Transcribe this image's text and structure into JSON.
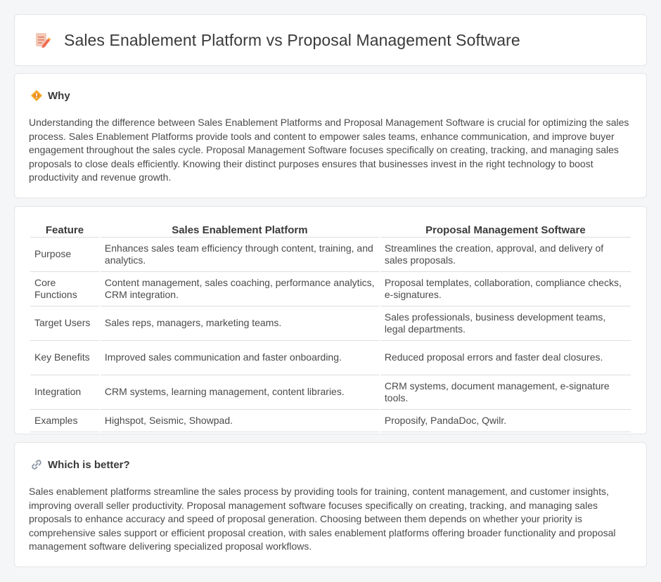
{
  "header": {
    "title": "Sales Enablement Platform vs Proposal Management Software",
    "icon": "document-pencil-icon"
  },
  "why": {
    "title": "Why",
    "icon": "diamond-icon",
    "text": "Understanding the difference between Sales Enablement Platforms and Proposal Management Software is crucial for optimizing the sales process. Sales Enablement Platforms provide tools and content to empower sales teams, enhance communication, and improve buyer engagement throughout the sales cycle. Proposal Management Software focuses specifically on creating, tracking, and managing sales proposals to close deals efficiently. Knowing their distinct purposes ensures that businesses invest in the right technology to boost productivity and revenue growth."
  },
  "table": {
    "headers": [
      "Feature",
      "Sales Enablement Platform",
      "Proposal Management Software"
    ],
    "rows": [
      [
        "Purpose",
        "Enhances sales team efficiency through content, training, and analytics.",
        "Streamlines the creation, approval, and delivery of sales proposals."
      ],
      [
        "Core Functions",
        "Content management, sales coaching, performance analytics, CRM integration.",
        "Proposal templates, collaboration, compliance checks, e-signatures."
      ],
      [
        "Target Users",
        "Sales reps, managers, marketing teams.",
        "Sales professionals, business development teams, legal departments."
      ],
      [
        "Key Benefits",
        "Improved sales communication and faster onboarding.",
        "Reduced proposal errors and faster deal closures."
      ],
      [
        "Integration",
        "CRM systems, learning management, content libraries.",
        "CRM systems, document management, e-signature tools."
      ],
      [
        "Examples",
        "Highspot, Seismic, Showpad.",
        "Proposify, PandaDoc, Qwilr."
      ]
    ]
  },
  "better": {
    "title": "Which is better?",
    "icon": "link-icon",
    "text": "Sales enablement platforms streamline the sales process by providing tools for training, content management, and customer insights, improving overall seller productivity. Proposal management software focuses specifically on creating, tracking, and managing sales proposals to enhance accuracy and speed of proposal generation. Choosing between them depends on whether your priority is comprehensive sales support or efficient proposal creation, with sales enablement platforms offering broader functionality and proposal management software delivering specialized proposal workflows."
  }
}
